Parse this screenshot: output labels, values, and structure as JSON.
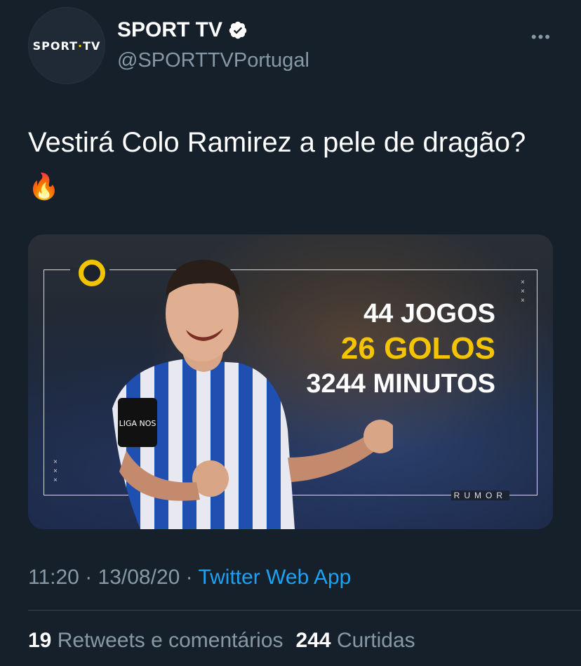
{
  "tweet": {
    "avatar_text_left": "SP",
    "avatar_text_o": "O",
    "avatar_text_mid": "RT",
    "avatar_text_dot": "·",
    "avatar_text_right": "TV",
    "display_name": "SPORT TV",
    "handle": "@SPORTTVPortugal",
    "more_label": "•••",
    "text": "Vestirá Colo Ramirez a pele de dragão?",
    "emoji": "🔥",
    "media": {
      "stat_1": "44 JOGOS",
      "stat_2": "26 GOLOS",
      "stat_3": "3244 MINUTOS",
      "tag": "RUMOR",
      "badge_text": "LIGA NOS",
      "accent_color": "#f5c400",
      "kit_color": "#1f4fb0"
    },
    "time": "11:20",
    "date": "13/08/20",
    "source": "Twitter Web App",
    "retweets_count": "19",
    "retweets_label": "Retweets e comentários",
    "likes_count": "244",
    "likes_label": "Curtidas"
  },
  "colors": {
    "background": "#15202b",
    "secondary_text": "#8899a6",
    "link": "#1da1f2",
    "verified": "#ffffff"
  }
}
